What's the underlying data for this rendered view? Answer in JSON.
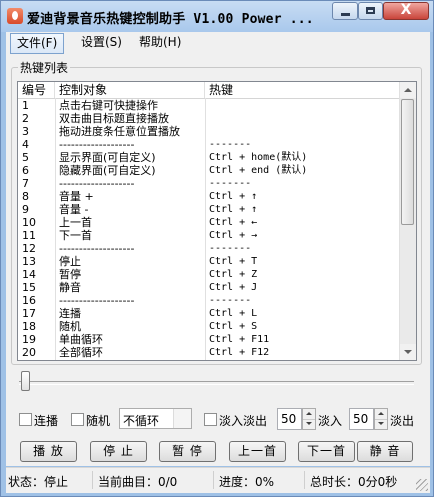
{
  "window": {
    "title": "爱迪背景音乐热键控制助手 V1.00 Power ...",
    "close_glyph": "X"
  },
  "menu": [
    {
      "label": "文件(F)"
    },
    {
      "label": "设置(S)"
    },
    {
      "label": "帮助(H)"
    }
  ],
  "hotkey_group": {
    "title": "热键列表"
  },
  "table": {
    "headers": [
      "编号",
      "控制对象",
      "热键"
    ],
    "rows": [
      [
        "1",
        "点击右键可快捷操作",
        ""
      ],
      [
        "2",
        "双击曲目标题直接播放",
        ""
      ],
      [
        "3",
        "拖动进度条任意位置播放",
        ""
      ],
      [
        "4",
        "-------------------",
        "-------"
      ],
      [
        "5",
        "显示界面(可自定义)",
        "Ctrl + home(默认)"
      ],
      [
        "6",
        "隐藏界面(可自定义)",
        "Ctrl + end (默认)"
      ],
      [
        "7",
        "-------------------",
        "-------"
      ],
      [
        "8",
        "音量 +",
        "Ctrl + ↑"
      ],
      [
        "9",
        "音量 -",
        "Ctrl + ↑"
      ],
      [
        "10",
        "上一首",
        "Ctrl + ←"
      ],
      [
        "11",
        "下一首",
        "Ctrl + →"
      ],
      [
        "12",
        "-------------------",
        "-------"
      ],
      [
        "13",
        "停止",
        "Ctrl + T"
      ],
      [
        "14",
        "暂停",
        "Ctrl + Z"
      ],
      [
        "15",
        "静音",
        "Ctrl + J"
      ],
      [
        "16",
        "-------------------",
        "-------"
      ],
      [
        "17",
        "连播",
        "Ctrl + L"
      ],
      [
        "18",
        "随机",
        "Ctrl + S"
      ],
      [
        "19",
        "单曲循环",
        "Ctrl + F11"
      ],
      [
        "20",
        "全部循环",
        "Ctrl + F12"
      ]
    ]
  },
  "progress": {
    "position": 0
  },
  "options": {
    "continuous_label": "连播",
    "continuous_checked": false,
    "random_label": "随机",
    "random_checked": false,
    "loop_mode": "不循环",
    "fade_label": "淡入淡出",
    "fade_checked": false,
    "fade_in_value": "50",
    "fade_in_label": "淡入",
    "fade_out_value": "50",
    "fade_out_label": "淡出"
  },
  "buttons": {
    "play": "播 放",
    "stop": "停 止",
    "pause": "暂 停",
    "prev": "上一首",
    "next": "下一首",
    "mute": "静 音"
  },
  "status": {
    "state": "状态：停止",
    "current": "当前曲目：0/0",
    "progress": "进度：0%",
    "duration": "总时长：0分0秒"
  }
}
